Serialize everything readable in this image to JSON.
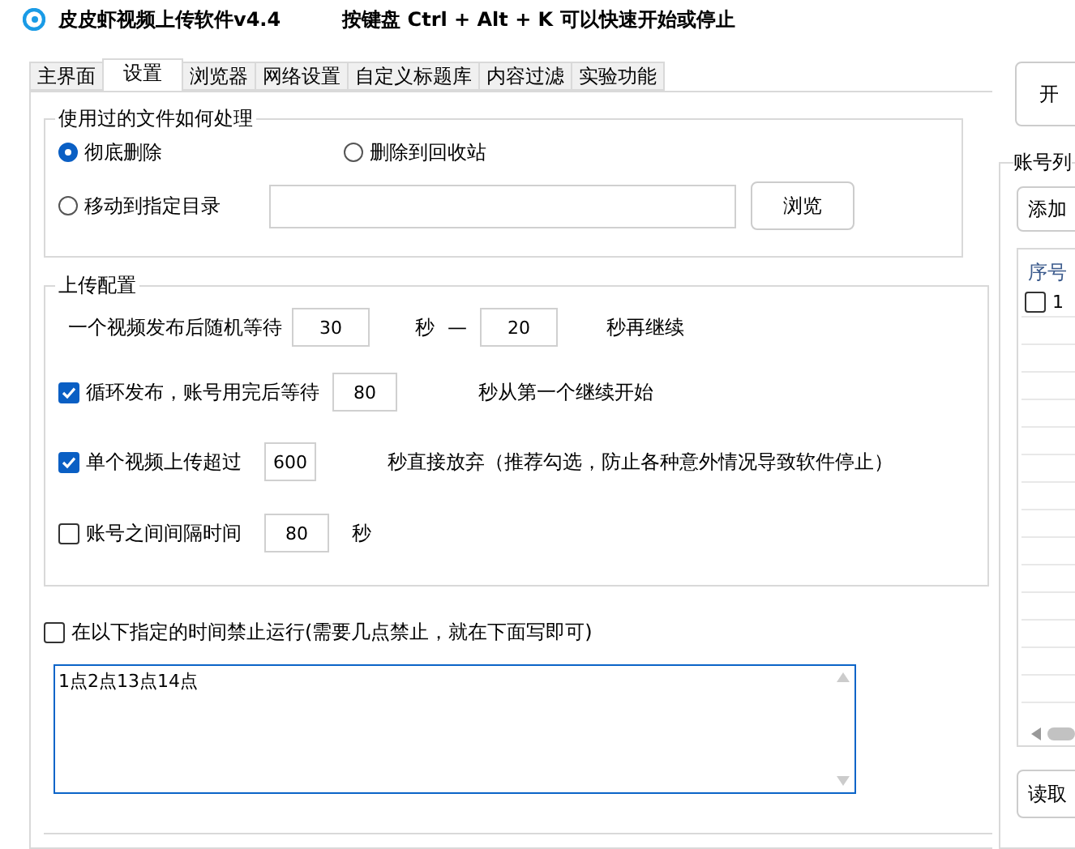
{
  "window": {
    "title": "皮皮虾视频上传软件v4.4",
    "hotkey_hint": "按键盘 Ctrl + Alt + K  可以快速开始或停止"
  },
  "tabs": [
    {
      "label": "主界面",
      "selected": false
    },
    {
      "label": "设置",
      "selected": true
    },
    {
      "label": "浏览器",
      "selected": false
    },
    {
      "label": "网络设置",
      "selected": false
    },
    {
      "label": "自定义标题库",
      "selected": false
    },
    {
      "label": "内容过滤",
      "selected": false
    },
    {
      "label": "实验功能",
      "selected": false
    }
  ],
  "file_handling": {
    "title": "使用过的文件如何处理",
    "options": [
      {
        "label": "彻底删除",
        "selected": true
      },
      {
        "label": "删除到回收站",
        "selected": false
      },
      {
        "label": "移动到指定目录",
        "selected": false
      }
    ],
    "browse_button": "浏览"
  },
  "upload_config": {
    "title": "上传配置",
    "rows": [
      {
        "kind": "range",
        "label": "一个视频发布后随机等待",
        "value": "30",
        "unit": "秒",
        "separator": "—",
        "value2": "20",
        "suffix": "秒再继续"
      },
      {
        "kind": "check",
        "checked": true,
        "label": "循环发布，账号用完后等待",
        "value": "80",
        "suffix": "秒从第一个继续开始"
      },
      {
        "kind": "check",
        "checked": true,
        "label": "单个视频上传超过",
        "value": "600",
        "suffix": "秒直接放弃（推荐勾选，防止各种意外情况导致软件停止）"
      },
      {
        "kind": "check",
        "checked": false,
        "label": "账号之间间隔时间",
        "value": "80",
        "suffix": "秒"
      }
    ]
  },
  "schedule": {
    "checked": false,
    "label": "在以下指定的时间禁止运行(需要几点禁止，就在下面写即可)",
    "text": "1点2点13点14点"
  },
  "right_panel": {
    "start_button": "开",
    "accounts": {
      "title": "账号列",
      "add_button": "添加",
      "columns": [
        "序号"
      ],
      "rows": [
        {
          "checked": false,
          "index": "1"
        }
      ],
      "read_button": "读取"
    }
  }
}
